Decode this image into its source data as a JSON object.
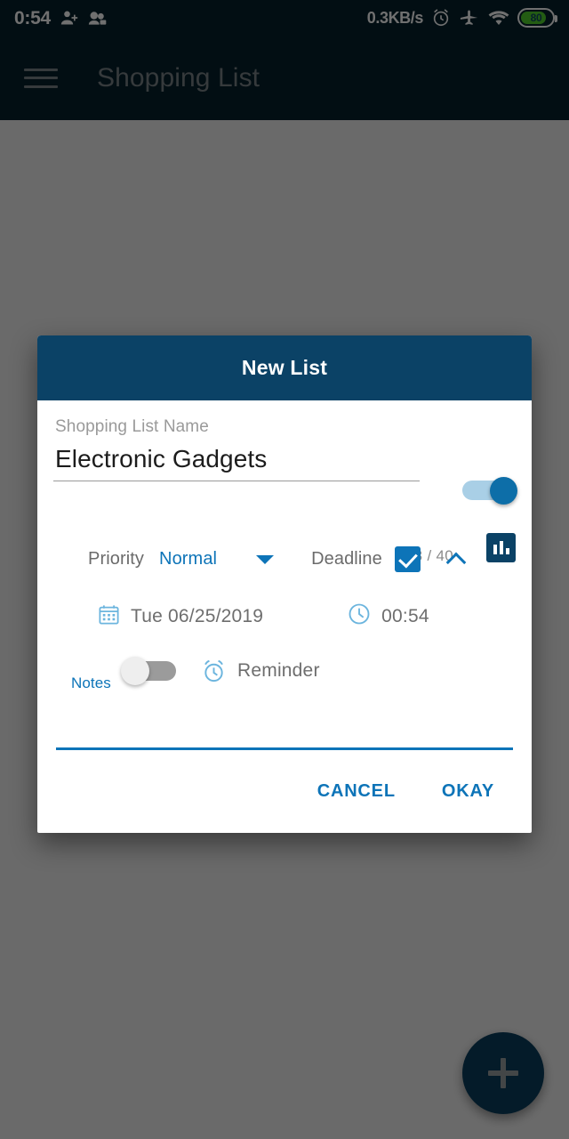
{
  "status_bar": {
    "clock": "0:54",
    "network_speed": "0.3KB/s",
    "battery_level": "80",
    "icons": [
      "person-add-icon",
      "contacts-icon",
      "alarm-icon",
      "airplane-mode-icon",
      "wifi-icon",
      "battery-icon"
    ]
  },
  "app_bar": {
    "menu_icon": "hamburger-menu-icon",
    "title": "Shopping List"
  },
  "fab": {
    "icon": "plus-icon",
    "label": "+"
  },
  "dialog": {
    "title": "New List",
    "name_field": {
      "label": "Shopping List Name",
      "value": "Electronic Gadgets",
      "placeholder": "Shopping List Name",
      "counter": "18 / 40"
    },
    "master_toggle": {
      "name": "list-enabled-toggle",
      "state": "on"
    },
    "chart_button": {
      "icon": "bar-chart-icon"
    },
    "priority": {
      "label": "Priority",
      "value": "Normal",
      "options": [
        "Normal"
      ]
    },
    "deadline": {
      "label": "Deadline",
      "checked": true
    },
    "date": {
      "icon": "calendar-icon",
      "value": "Tue 06/25/2019"
    },
    "time": {
      "icon": "clock-icon",
      "value": "00:54"
    },
    "reminder": {
      "icon": "alarm-clock-icon",
      "label": "Reminder",
      "state": "off"
    },
    "notes": {
      "label": "Notes",
      "value": "",
      "placeholder": ""
    },
    "actions": {
      "cancel": "CANCEL",
      "okay": "OKAY"
    }
  },
  "colors": {
    "header_navy": "#0b4266",
    "accent_blue": "#0d74b8",
    "icon_light_blue": "#6cb5de",
    "status_bar_dark": "#06202c",
    "battery_green": "#51d12c",
    "scrim": "#636363"
  }
}
